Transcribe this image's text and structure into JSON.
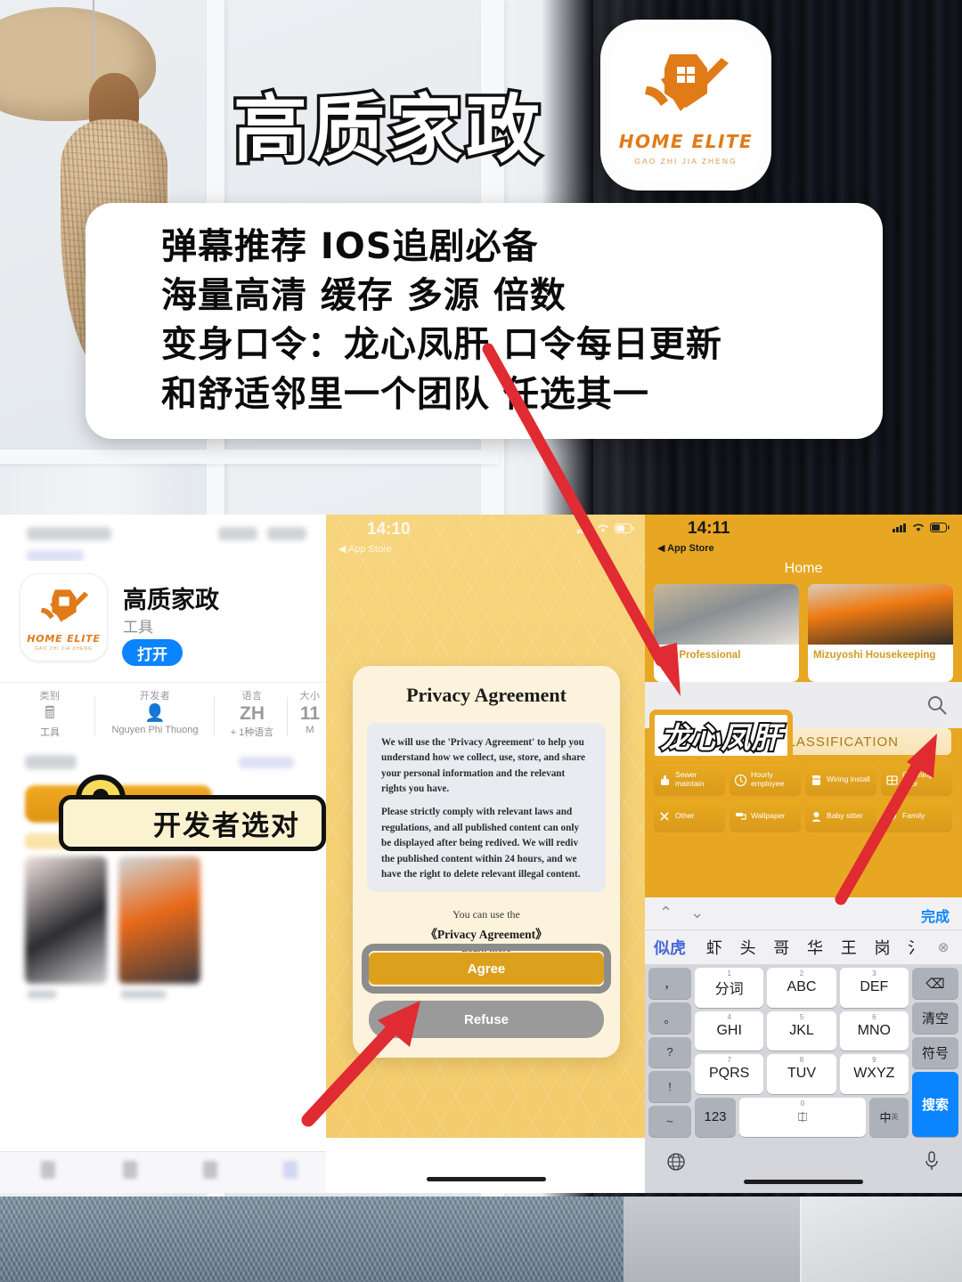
{
  "poster": {
    "headline": "高质家政",
    "promo_lines": [
      "弹幕推荐 IOS追剧必备",
      "海量高清 缓存 多源 倍数",
      "变身口令：龙心凤肝 口令每日更新",
      "和舒适邻里一个团队 任选其一"
    ],
    "logo": {
      "name": "HOME ELITE",
      "subtitle": "GAO ZHI JIA ZHENG",
      "accent": "#e07b18",
      "icon": "house-check-icon"
    },
    "stickers": {
      "developer_note": "开发者选对",
      "search_keyword": "龙心凤肝"
    }
  },
  "app_store": {
    "app_name": "高质家政",
    "category_label": "工具",
    "open_button": "打开",
    "info": [
      {
        "header": "类别",
        "icon": "calculator-icon",
        "value": "工具"
      },
      {
        "header": "开发者",
        "icon": "person-card-icon",
        "value": "Nguyen Phi Thuong"
      },
      {
        "header": "语言",
        "icon": "ZH",
        "value": "+ 1种语言"
      },
      {
        "header": "大小",
        "icon": "11",
        "value": "M"
      }
    ]
  },
  "privacy_phone": {
    "status": {
      "time": "14:10",
      "back_label": "App Store"
    },
    "dialog": {
      "title": "Privacy Agreement",
      "paragraphs": [
        "We will use the 'Privacy Agreement' to help you understand how we collect, use, store, and share your personal information and the relevant rights you have.",
        "Please strictly comply with relevant laws and regulations, and all published content can only be displayed after being redived. We will rediv the published content within 24 hours, and we have the right to delete relevant illegal content."
      ],
      "footer_line1": "You can use the",
      "footer_line2": "《Privacy Agreement》",
      "footer_line3": "Learn more",
      "agree_button": "Agree",
      "refuse_button": "Refuse",
      "agree_color": "#dda01c",
      "refuse_color": "#9a9a9a"
    }
  },
  "home_phone": {
    "status": {
      "time": "14:11",
      "back_label": "App Store"
    },
    "nav_title": "Home",
    "cards": [
      {
        "title": "Pro Professional"
      },
      {
        "title": "Mizuyoshi Housekeeping"
      }
    ],
    "search_placeholder": "",
    "section_title": "SERVICE CLASSIFICATION",
    "services": [
      {
        "label": "Sewer maintain",
        "icon": "sewer-icon"
      },
      {
        "label": "Hourly employee",
        "icon": "clock-icon"
      },
      {
        "label": "Wiring install",
        "icon": "appliance-icon"
      },
      {
        "label": "Cleaning door",
        "icon": "window-icon"
      },
      {
        "label": "Other",
        "icon": "tools-icon"
      },
      {
        "label": "Wallpaper",
        "icon": "roller-icon"
      },
      {
        "label": "Baby sitter",
        "icon": "baby-icon"
      },
      {
        "label": "Family",
        "icon": "heart-icon"
      }
    ],
    "keyboard": {
      "done_label": "完成",
      "candidates": [
        "似虎",
        "虾",
        "头",
        "哥",
        "华",
        "王",
        "岗",
        "氵"
      ],
      "delete_icon": "backspace-icon",
      "left_column": [
        "，",
        "。",
        "?",
        "!",
        "~"
      ],
      "keys": [
        {
          "num": "1",
          "label": "分词"
        },
        {
          "num": "2",
          "label": "ABC"
        },
        {
          "num": "3",
          "label": "DEF"
        },
        {
          "num": "4",
          "label": "GHI"
        },
        {
          "num": "5",
          "label": "JKL"
        },
        {
          "num": "6",
          "label": "MNO"
        },
        {
          "num": "7",
          "label": "PQRS"
        },
        {
          "num": "8",
          "label": "TUV"
        },
        {
          "num": "9",
          "label": "WXYZ"
        }
      ],
      "right_column": [
        "清空",
        "符号"
      ],
      "search_key": "搜索",
      "num_key": "123",
      "space_num": "0",
      "lang_key": "中",
      "lang_sub": "英",
      "globe_icon": "globe-icon",
      "mic_icon": "microphone-icon"
    }
  }
}
